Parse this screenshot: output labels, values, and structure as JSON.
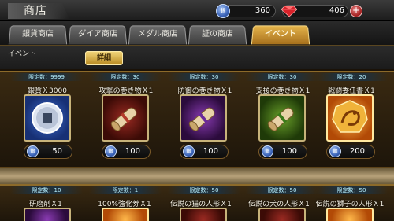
{
  "header": {
    "title": "商店",
    "silver_amount": "360",
    "gem_amount": "406",
    "coin_label": "銀",
    "plus_label": "+"
  },
  "tabs": [
    {
      "label": "銀貨商店",
      "active": false
    },
    {
      "label": "ダイア商店",
      "active": false
    },
    {
      "label": "メダル商店",
      "active": false
    },
    {
      "label": "証の商店",
      "active": false
    },
    {
      "label": "イベント",
      "active": true
    }
  ],
  "event_bar": {
    "label": "イベント",
    "detail_button": "詳細"
  },
  "row1": [
    {
      "limit": "限定数：9999",
      "name": "銀貨Ｘ3000",
      "price": "50",
      "icon": "silver-coin-icon",
      "color": "#3f6ed0"
    },
    {
      "limit": "限定数：30",
      "name": "攻撃の巻き物Ｘ1",
      "price": "100",
      "icon": "scroll-icon",
      "color": "#9b2a22"
    },
    {
      "limit": "限定数：30",
      "name": "防御の巻き物Ｘ1",
      "price": "100",
      "icon": "scroll-icon",
      "color": "#8a3bb3"
    },
    {
      "limit": "限定数：30",
      "name": "支援の巻き物Ｘ1",
      "price": "100",
      "icon": "scroll-icon",
      "color": "#6aa12a"
    },
    {
      "limit": "限定数：20",
      "name": "戦闘委任書Ｘ1",
      "price": "200",
      "icon": "dragon-emblem-icon",
      "color": "#ffb84a"
    }
  ],
  "row2": [
    {
      "limit": "限定数：10",
      "name": "研磨剤Ｘ1"
    },
    {
      "limit": "限定数：1",
      "name": "100%強化券Ｘ1"
    },
    {
      "limit": "限定数：50",
      "name": "伝説の猫の人形Ｘ1"
    },
    {
      "limit": "限定数：50",
      "name": "伝説の犬の人形Ｘ1"
    },
    {
      "limit": "限定数：50",
      "name": "伝説の獅子の人形Ｘ1"
    }
  ]
}
